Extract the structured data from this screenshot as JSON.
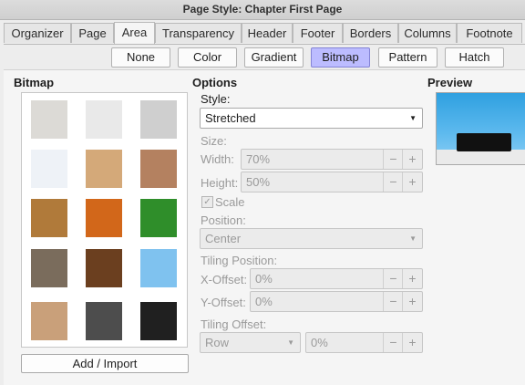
{
  "window": {
    "title": "Page Style: Chapter First Page"
  },
  "tabs": [
    {
      "label": "Organizer"
    },
    {
      "label": "Page"
    },
    {
      "label": "Area"
    },
    {
      "label": "Transparency"
    },
    {
      "label": "Header"
    },
    {
      "label": "Footer"
    },
    {
      "label": "Borders"
    },
    {
      "label": "Columns"
    },
    {
      "label": "Footnote"
    }
  ],
  "active_tab": "Area",
  "fill_types": [
    {
      "label": "None"
    },
    {
      "label": "Color"
    },
    {
      "label": "Gradient"
    },
    {
      "label": "Bitmap"
    },
    {
      "label": "Pattern"
    },
    {
      "label": "Hatch"
    }
  ],
  "active_fill": "Bitmap",
  "bitmap": {
    "heading": "Bitmap",
    "add_import_label": "Add / Import",
    "tiles": [
      {
        "name": "paper-tile",
        "color": "#dcdad6"
      },
      {
        "name": "white-paper-tile",
        "color": "#e9e9e9"
      },
      {
        "name": "crumpled-paper-tile",
        "color": "#cfcfcf"
      },
      {
        "name": "grid-paper-tile",
        "color": "#eef2f7"
      },
      {
        "name": "parchment-tile",
        "color": "#d4a979"
      },
      {
        "name": "wood-planks-tile",
        "color": "#b48160"
      },
      {
        "name": "wood-tile",
        "color": "#b07a3a"
      },
      {
        "name": "autumn-leaves-tile",
        "color": "#d2671a"
      },
      {
        "name": "grass-tile",
        "color": "#2f8e2a"
      },
      {
        "name": "pebbles-tile",
        "color": "#7a6c5c"
      },
      {
        "name": "coffee-beans-tile",
        "color": "#6b3f1f"
      },
      {
        "name": "sky-clouds-tile",
        "color": "#7fc2ef"
      },
      {
        "name": "color-squares-tile",
        "color": "#c9a07a"
      },
      {
        "name": "stone-tile",
        "color": "#4d4d4d"
      },
      {
        "name": "zebra-tile",
        "color": "#202020"
      }
    ]
  },
  "options": {
    "heading": "Options",
    "style_label": "Style:",
    "style_value": "Stretched",
    "size_label": "Size:",
    "width_label": "Width:",
    "width_value": "70%",
    "height_label": "Height:",
    "height_value": "50%",
    "scale_label": "Scale",
    "position_label": "Position:",
    "position_value": "Center",
    "tiling_position_label": "Tiling Position:",
    "x_offset_label": "X-Offset:",
    "x_offset_value": "0%",
    "y_offset_label": "Y-Offset:",
    "y_offset_value": "0%",
    "tiling_offset_label": "Tiling Offset:",
    "tiling_offset_mode": "Row",
    "tiling_offset_value": "0%",
    "minus": "−",
    "plus": "+"
  },
  "preview": {
    "heading": "Preview"
  }
}
